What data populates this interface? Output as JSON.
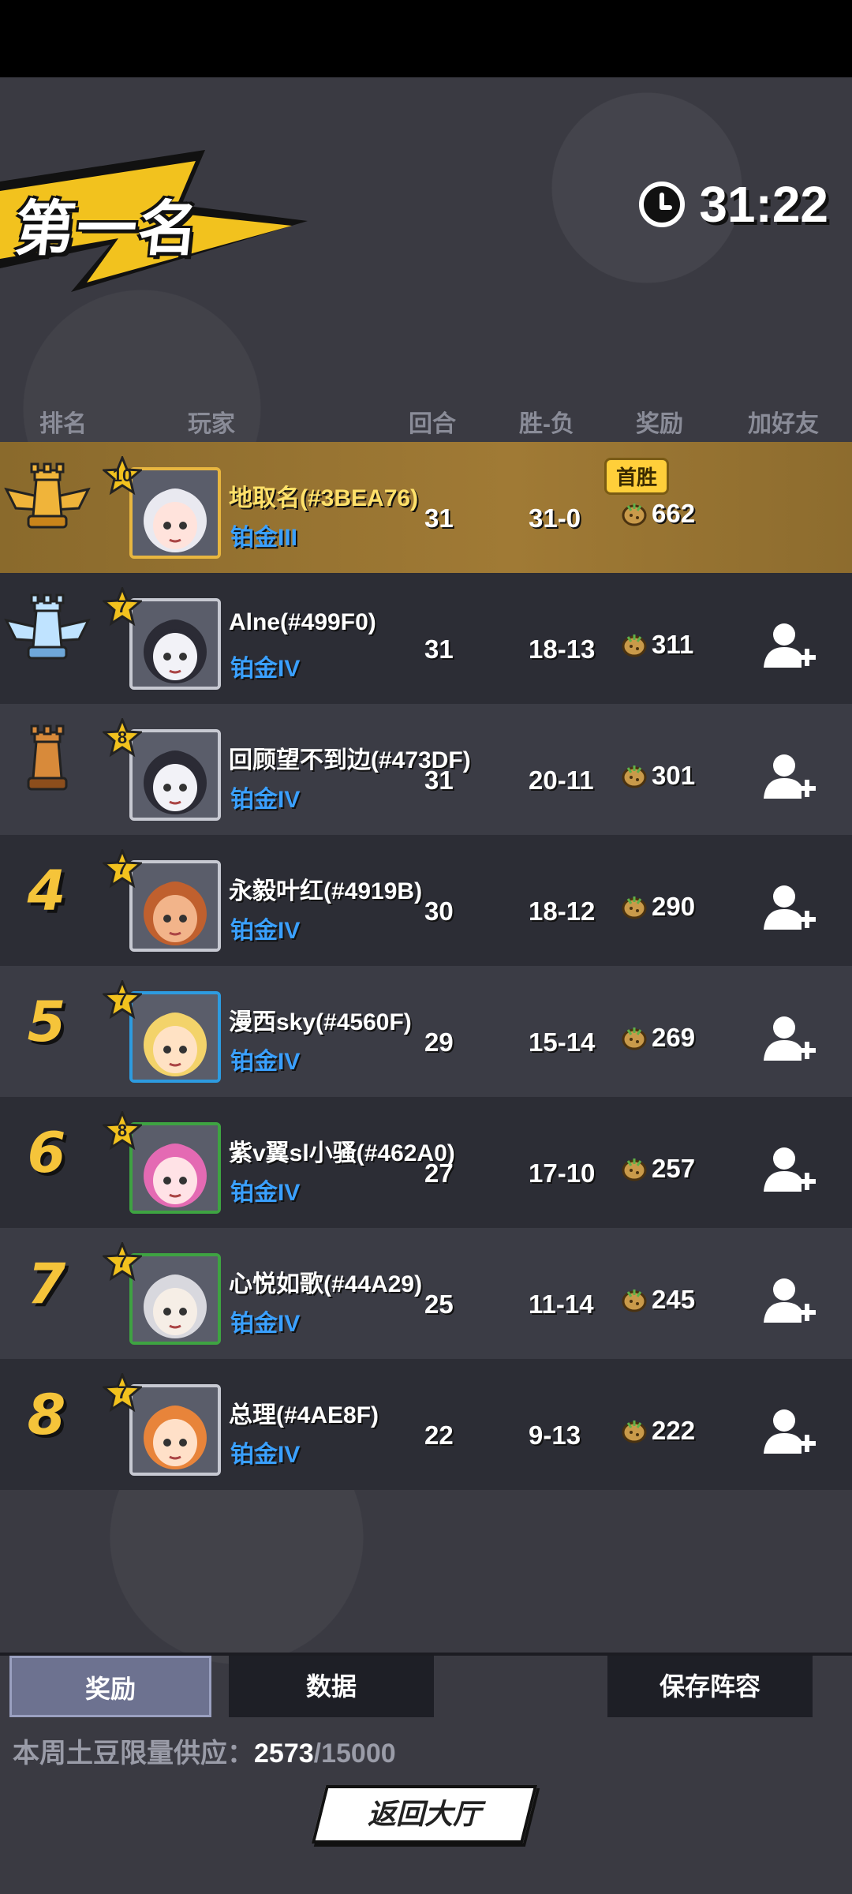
{
  "header": {
    "place_title": "第一名",
    "timer": "31:22"
  },
  "columns": {
    "rank": "排名",
    "player": "玩家",
    "round": "回合",
    "win_loss": "胜-负",
    "reward": "奖励",
    "add_friend": "加好友"
  },
  "badge": {
    "first_win": "首胜"
  },
  "players": [
    {
      "rank": "1",
      "rank_kind": "gold",
      "level": "10",
      "name": "地取名(#3BEA76)",
      "tier": "铂金III",
      "round": "31",
      "win_loss": "31-0",
      "reward": "662",
      "first_win": true,
      "self": true,
      "frame": "gold",
      "hair": "#e9e9f0",
      "skin": "#ffe3dc"
    },
    {
      "rank": "2",
      "rank_kind": "silver",
      "level": "7",
      "name": "Alne(#499F0)",
      "tier": "铂金IV",
      "round": "31",
      "win_loss": "18-13",
      "reward": "311",
      "frame": "plain",
      "hair": "#2b2b35",
      "skin": "#f2f2f7"
    },
    {
      "rank": "3",
      "rank_kind": "bronze",
      "level": "8",
      "name": "回顾望不到边(#473DF)",
      "tier": "铂金IV",
      "round": "31",
      "win_loss": "20-11",
      "reward": "301",
      "frame": "plain",
      "hair": "#2b2b35",
      "skin": "#f2f2f7"
    },
    {
      "rank": "4",
      "rank_kind": "number",
      "level": "7",
      "name": "永毅叶红(#4919B)",
      "tier": "铂金IV",
      "round": "30",
      "win_loss": "18-12",
      "reward": "290",
      "frame": "plain",
      "hair": "#c0602e",
      "skin": "#f2b48a"
    },
    {
      "rank": "5",
      "rank_kind": "number",
      "level": "7",
      "name": "漫西sky(#4560F)",
      "tier": "铂金IV",
      "round": "29",
      "win_loss": "15-14",
      "reward": "269",
      "frame": "blue",
      "hair": "#f3d36a",
      "skin": "#ffe2c4"
    },
    {
      "rank": "6",
      "rank_kind": "number",
      "level": "8",
      "name": "紫v翼sl小骚(#462A0)",
      "tier": "铂金IV",
      "round": "27",
      "win_loss": "17-10",
      "reward": "257",
      "frame": "green",
      "hair": "#e46ab3",
      "skin": "#ffe2e6"
    },
    {
      "rank": "7",
      "rank_kind": "number",
      "level": "7",
      "name": "心悦如歌(#44A29)",
      "tier": "铂金IV",
      "round": "25",
      "win_loss": "11-14",
      "reward": "245",
      "frame": "green",
      "hair": "#d8d8de",
      "skin": "#f6eee6"
    },
    {
      "rank": "8",
      "rank_kind": "number",
      "level": "7",
      "name": "总理(#4AE8F)",
      "tier": "铂金IV",
      "round": "22",
      "win_loss": "9-13",
      "reward": "222",
      "frame": "plain",
      "hair": "#e8843a",
      "skin": "#ffe0c8"
    }
  ],
  "tabs": {
    "reward": "奖励",
    "data": "数据",
    "save_lineup": "保存阵容"
  },
  "supply": {
    "label": "本周土豆限量供应：",
    "current": "2573",
    "max": "/15000"
  },
  "back_button": "返回大厅",
  "colors": {
    "gold": "#f5c43a",
    "tier_blue": "#3aa0ff",
    "first_row": "#a07a35"
  }
}
